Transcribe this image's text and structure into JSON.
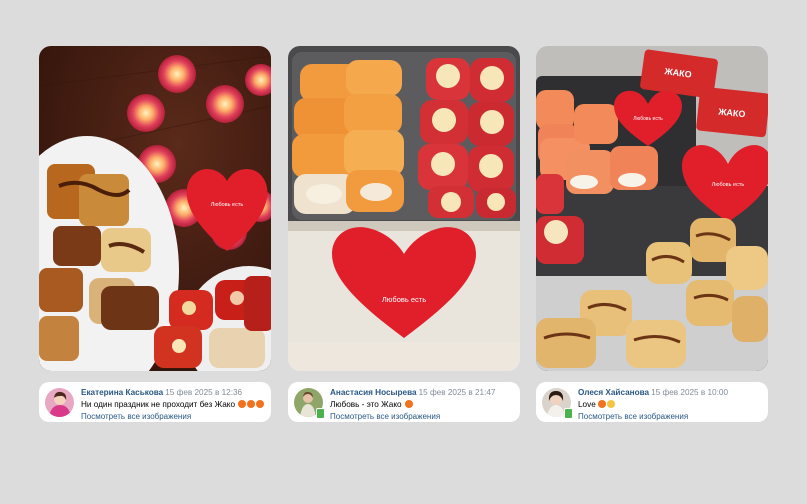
{
  "reviews": [
    {
      "author": "Екатерина Каськова",
      "date": "15 фев 2025 в 12:36",
      "text": "Ни один праздник не проходит без Жако",
      "emojis": [
        "orange-heart",
        "orange-heart",
        "orange-heart"
      ],
      "link": "Посмотреть все изображения",
      "heart_label": "Любовь есть"
    },
    {
      "author": "Анастасия Носырева",
      "date": "15 фев 2025 в 21:47",
      "text": "Любовь - это Жако",
      "emojis": [
        "orange-heart"
      ],
      "link": "Посмотреть все изображения",
      "heart_label": "Любовь есть"
    },
    {
      "author": "Олеся Хайсанова",
      "date": "15 фев 2025 в 10:00",
      "text": "Love",
      "emojis": [
        "orange-heart",
        "clapping-hands"
      ],
      "link": "Посмотреть все изображения",
      "heart_label": "Любовь есть",
      "brand_text": "ЖАКО"
    }
  ],
  "colors": {
    "link": "#2a5885",
    "date": "#818c99",
    "heart": "#e01f2b",
    "emoji_heart": "#f2711c",
    "emoji_hands": "#f5c542"
  }
}
